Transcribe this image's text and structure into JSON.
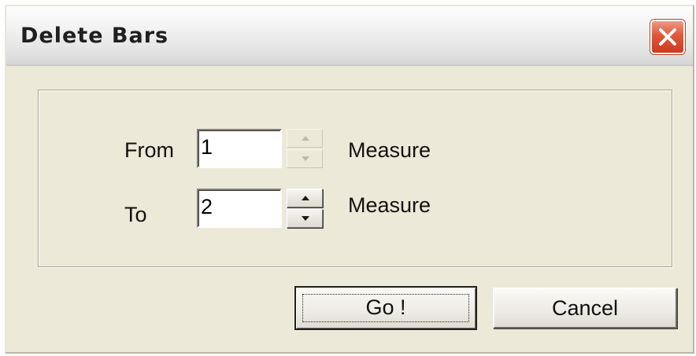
{
  "window": {
    "title": "Delete Bars",
    "close_icon": "close-icon"
  },
  "range": {
    "from_label": "From",
    "from_value": "1",
    "from_unit": "Measure",
    "from_spinner_enabled": false,
    "to_label": "To",
    "to_value": "2",
    "to_unit": "Measure",
    "to_spinner_enabled": true
  },
  "buttons": {
    "go_label": "Go !",
    "cancel_label": "Cancel"
  },
  "colors": {
    "dialog_face": "#ece9d8",
    "close_button": "#e0573a"
  }
}
